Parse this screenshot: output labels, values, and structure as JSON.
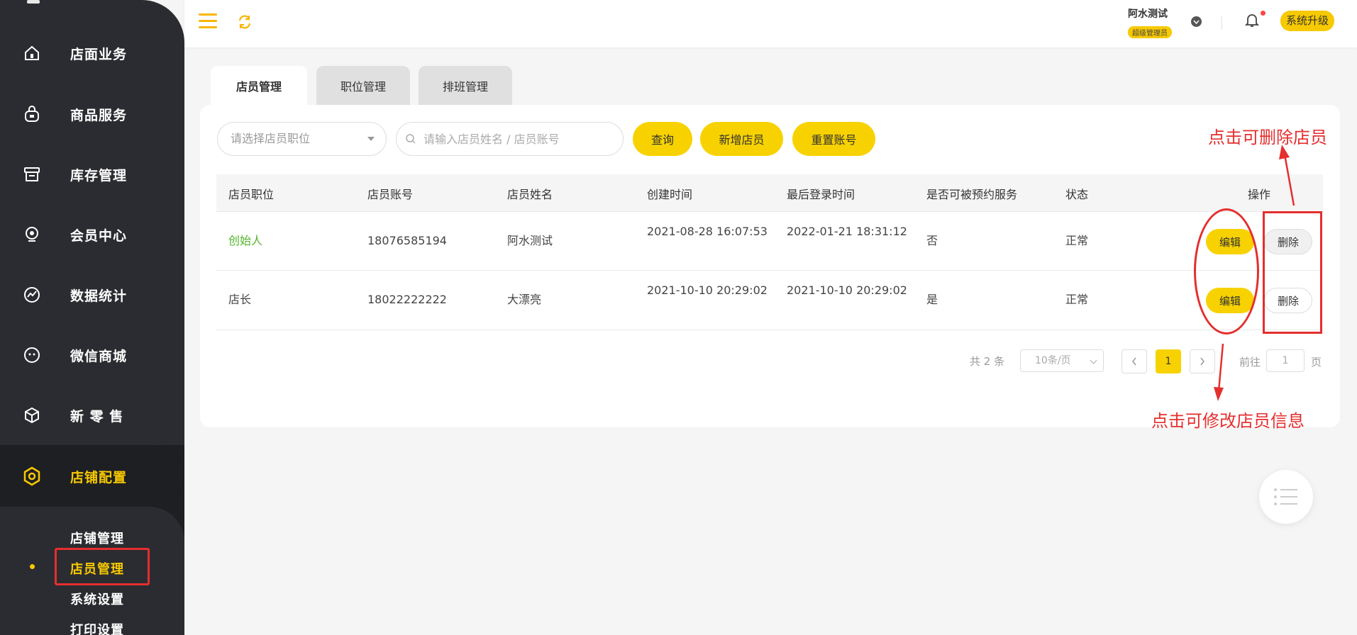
{
  "sidebar": {
    "items": [
      {
        "label": "店面业务",
        "icon": "home-icon"
      },
      {
        "label": "商品服务",
        "icon": "bag-icon"
      },
      {
        "label": "库存管理",
        "icon": "archive-icon"
      },
      {
        "label": "会员中心",
        "icon": "member-icon"
      },
      {
        "label": "数据统计",
        "icon": "chart-icon"
      },
      {
        "label": "微信商城",
        "icon": "wechat-icon"
      },
      {
        "label": "新 零 售",
        "icon": "box-icon"
      },
      {
        "label": "店铺配置",
        "icon": "settings-icon",
        "active": true
      }
    ],
    "sub_items": [
      {
        "label": "店铺管理"
      },
      {
        "label": "店员管理",
        "active": true
      },
      {
        "label": "系统设置"
      },
      {
        "label": "打印设置"
      }
    ]
  },
  "header": {
    "user_name": "阿水测试",
    "user_role": "超级管理员",
    "upgrade_label": "系统升级"
  },
  "tabs": [
    {
      "label": "店员管理",
      "active": true
    },
    {
      "label": "职位管理"
    },
    {
      "label": "排班管理"
    }
  ],
  "filters": {
    "position_placeholder": "请选择店员职位",
    "search_placeholder": "请输入店员姓名 / 店员账号",
    "query_label": "查询",
    "add_label": "新增店员",
    "reset_label": "重置账号"
  },
  "table": {
    "columns": [
      "店员职位",
      "店员账号",
      "店员姓名",
      "创建时间",
      "最后登录时间",
      "是否可被预约服务",
      "状态",
      "操作"
    ],
    "rows": [
      {
        "position": "创始人",
        "account": "18076585194",
        "name": "阿水测试",
        "created": "2021-08-28 16:07:53",
        "last_login": "2022-01-21 18:31:12",
        "bookable": "否",
        "status": "正常",
        "edit": "编辑",
        "delete": "删除"
      },
      {
        "position": "店长",
        "account": "18022222222",
        "name": "大漂亮",
        "created": "2021-10-10 20:29:02",
        "last_login": "2021-10-10 20:29:02",
        "bookable": "是",
        "status": "正常",
        "edit": "编辑",
        "delete": "删除"
      }
    ]
  },
  "pagination": {
    "total": "共 2 条",
    "page_size": "10条/页",
    "current": "1",
    "goto": "前往",
    "goto_value": "1",
    "page_suffix": "页"
  },
  "annotations": {
    "delete_note": "点击可删除店员",
    "edit_note": "点击可修改店员信息"
  },
  "colors": {
    "accent": "#f7d200",
    "sidebar": "#2b2c31",
    "annotation": "#e52e2e",
    "founder": "#52b52b"
  }
}
